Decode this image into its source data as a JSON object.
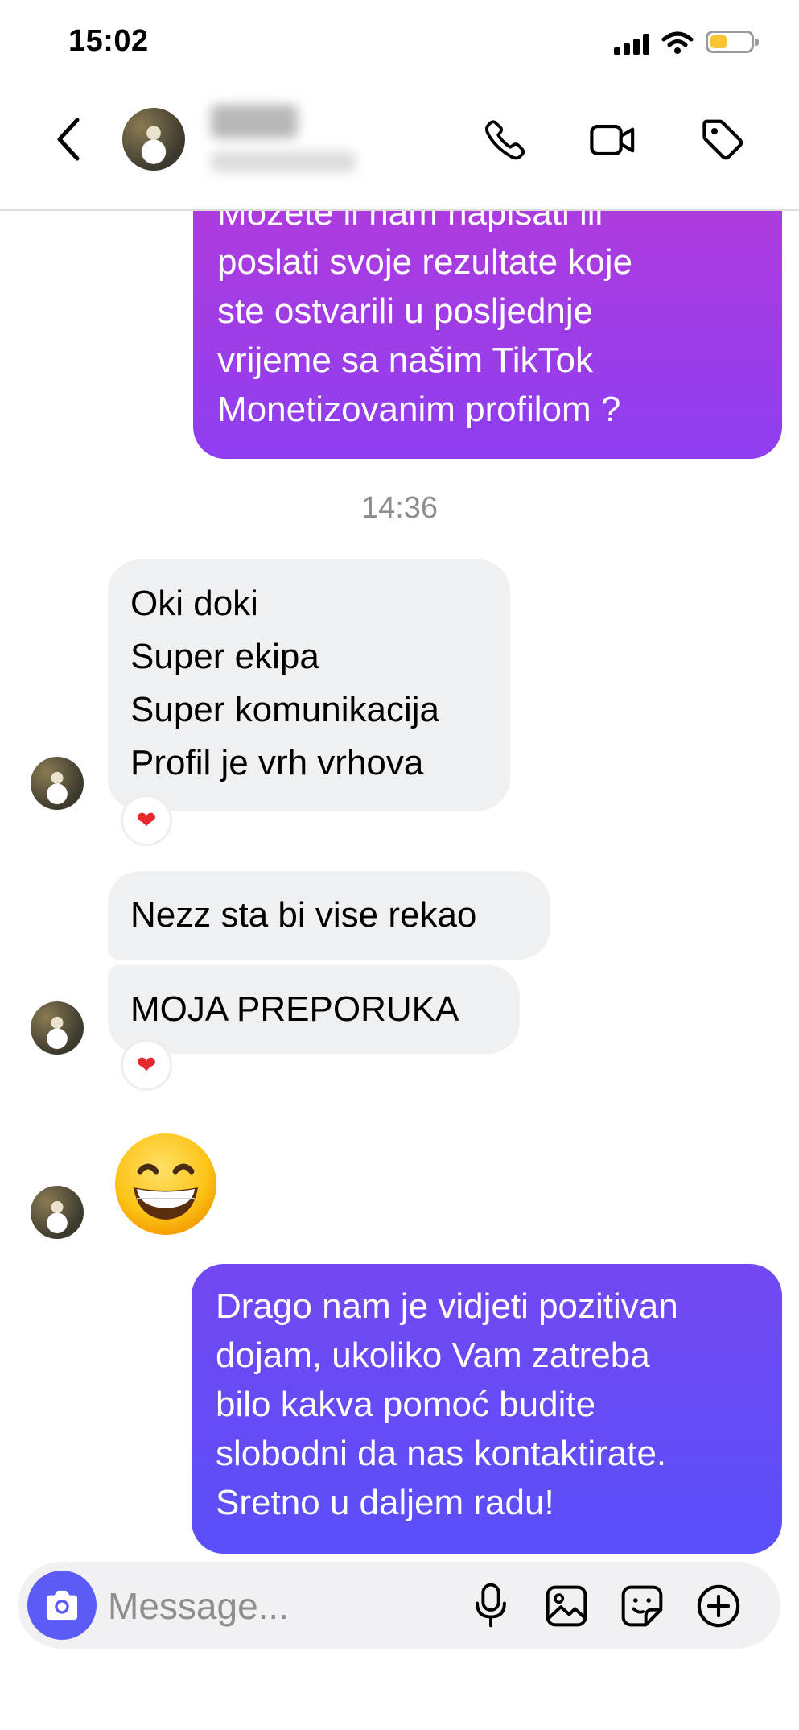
{
  "status_bar": {
    "time": "15:02"
  },
  "header": {
    "contact_name_hidden": true
  },
  "messages": {
    "outgoing_1": "Možete li nam napisati ili\nposlati svoje rezultate koje\nste ostvarili u posljednje\nvrijeme sa našim TikTok\nMonetizovanim profilom ?",
    "timestamp": "14:36",
    "incoming_1": "Oki doki\nSuper ekipa\nSuper komunikacija\nProfil je vrh vrhova",
    "incoming_1_reaction": "❤",
    "incoming_2": "Nezz sta bi vise rekao",
    "incoming_3": "MOJA PREPORUKA",
    "incoming_3_reaction": "❤",
    "incoming_4_emoji": "grinning-face",
    "outgoing_2": "Drago nam je vidjeti pozitivan\ndojam, ukoliko Vam zatreba\nbilo kakva pomoć budite\nslobodni da nas kontaktirate.\nSretno u daljem radu!"
  },
  "composer": {
    "placeholder": "Message..."
  },
  "colors": {
    "outgoing_1_gradient": [
      "#b13bdc",
      "#8e3ef0"
    ],
    "outgoing_2_gradient": [
      "#7248f3",
      "#5a4ff8"
    ],
    "incoming_bubble": "#eff0f2",
    "camera_button": "#5b5cf6",
    "battery": "#f6c531"
  },
  "icons": [
    "back-chevron-icon",
    "phone-icon",
    "video-camera-icon",
    "tag-icon",
    "camera-icon",
    "microphone-icon",
    "gallery-icon",
    "sticker-icon",
    "plus-circle-icon",
    "heart-icon"
  ]
}
